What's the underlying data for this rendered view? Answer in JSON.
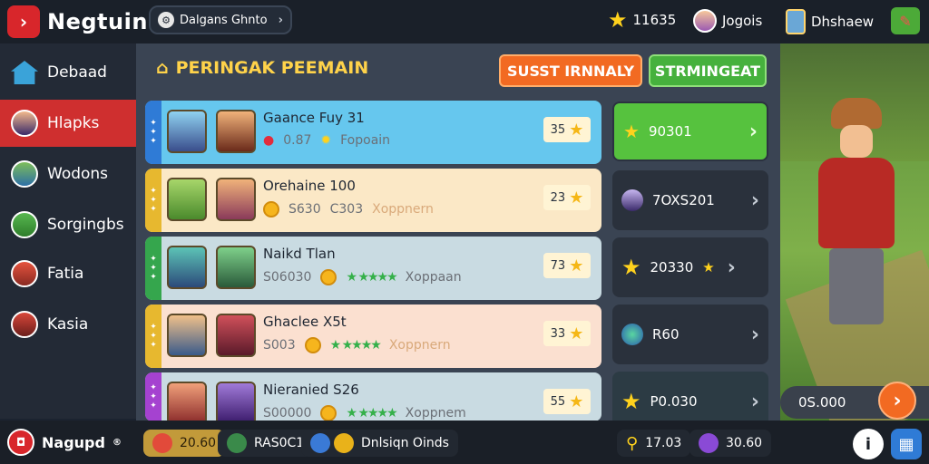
{
  "top": {
    "logo_text": "Negtuin",
    "logo_icon": "›",
    "dropdown_label": "Dalgans Ghnto",
    "dropdown_icon": "⚙",
    "dropdown_chevron": "›",
    "star_count": "11635",
    "profile_name": "Jogois",
    "device_label": "Dhshaew",
    "tag_icon": "✎"
  },
  "sidebar": {
    "items": [
      {
        "label": "Debaad",
        "icon": "home-icon"
      },
      {
        "label": "Hlapks",
        "icon": "avatar"
      },
      {
        "label": "Wodons",
        "icon": "avatar"
      },
      {
        "label": "Sorgingbs",
        "icon": "avatar"
      },
      {
        "label": "Fatia",
        "icon": "avatar"
      },
      {
        "label": "Kasia",
        "icon": "avatar"
      }
    ]
  },
  "main": {
    "title": "PERINGAK PEEMAIN",
    "title_icon": "⌂",
    "btn_primary": "SUSST IRNNALY",
    "btn_secondary": "STRMINGEAT",
    "rows": [
      {
        "name": "Gaance Fuy 31",
        "stat1": "0.87",
        "stat2": "Fopoain",
        "rank": "35",
        "stripe": "#2f7bd6",
        "bg": "#66c7ee"
      },
      {
        "name": "Orehaine 100",
        "stat1": "S630",
        "stat2": "C303",
        "stat3": "Xoppnern",
        "rank": "23",
        "stripe": "#e7b82f",
        "bg": "#fbe8c6"
      },
      {
        "name": "Naikd Tlan",
        "stat1": "S06030",
        "stat2": "Xoppaan",
        "rank": "73",
        "stripe": "#35a64d",
        "bg": "#c9dbe2"
      },
      {
        "name": "Ghaclee X5t",
        "stat1": "S003",
        "stat2": "Xoppnern",
        "rank": "33",
        "stripe": "#e7b82f",
        "bg": "#fbe0d0"
      },
      {
        "name": "Nieranied S26",
        "stat1": "S00000",
        "stat2": "Xoppnem",
        "rank": "55",
        "stripe": "#a542d0",
        "bg": "#c9dbe2"
      }
    ],
    "side_cards": [
      {
        "label": "90301"
      },
      {
        "label": "7OXS201"
      },
      {
        "label": "20330"
      },
      {
        "label": "R60"
      },
      {
        "label": "P0.030"
      }
    ]
  },
  "scene": {
    "pill_label": "0S.000",
    "play_icon": "›"
  },
  "bottom": {
    "logo_text": "Nagupd",
    "logo_sup": "®",
    "chip1": "20.60",
    "chip2": "RAS0C1",
    "chip3": "Dnlsiqn Oinds",
    "chip4": "17.03",
    "chip5": "30.60",
    "info_icon": "i",
    "grid_icon": "▦"
  },
  "colors": {
    "accent_red": "#cf2f2f",
    "accent_orange": "#f26a22",
    "accent_green": "#46b13d",
    "gold": "#ffd34a"
  }
}
